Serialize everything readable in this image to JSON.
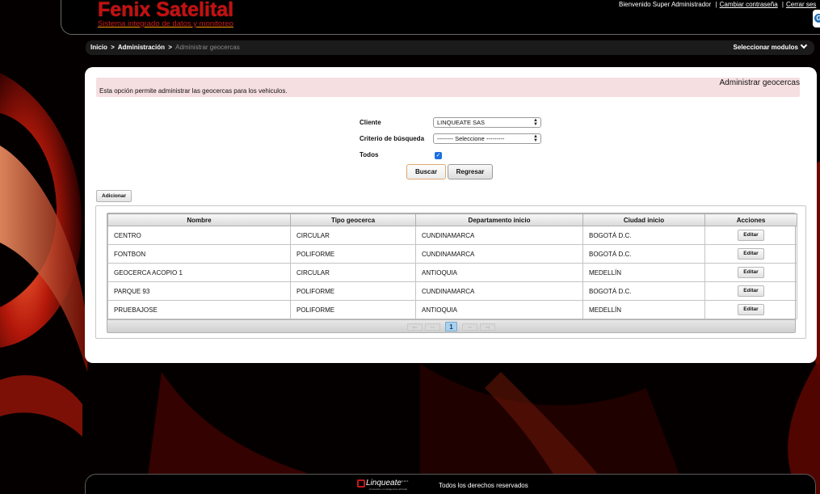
{
  "header": {
    "brand_title": "Fenix Satelital",
    "brand_subtitle": "Sistema integrado de datos y monitoreo",
    "welcome_text": "Bienvenido Super Administrador",
    "separator": "|",
    "change_password": "Cambiar contraseña",
    "logout": "Cerrar ses",
    "side_tab_glyph": "G"
  },
  "breadcrumb": {
    "items": [
      "Inicio",
      "Administración"
    ],
    "arrow": ">",
    "current": "Administrar geocercas",
    "module_select": "Seleccionar modulos"
  },
  "info": {
    "title": "Administrar geocercas",
    "text": "Esta opción permite administrar las geocercas para los vehiculos."
  },
  "form": {
    "cliente_label": "Cliente",
    "cliente_value": "LINQUEATE SAS",
    "criterio_label": "Criterio de búsqueda",
    "criterio_value": "-------- Seleccione ---------",
    "todos_label": "Todos",
    "todos_checked": true,
    "search_button": "Buscar",
    "back_button": "Regresar"
  },
  "add_button": "Adicionar",
  "table": {
    "headers": [
      "Nombre",
      "Tipo geocerca",
      "Departamento inicio",
      "Ciudad inicio",
      "Acciones"
    ],
    "rows": [
      [
        "CENTRO",
        "CIRCULAR",
        "CUNDINAMARCA",
        "BOGOTÁ D.C.",
        "Editar"
      ],
      [
        "FONTBON",
        "POLIFORME",
        "CUNDINAMARCA",
        "BOGOTÁ D.C.",
        "Editar"
      ],
      [
        "GEOCERCA ACOPIO 1",
        "CIRCULAR",
        "ANTIOQUIA",
        "MEDELLÍN",
        "Editar"
      ],
      [
        "PARQUE 93",
        "POLIFORME",
        "CUNDINAMARCA",
        "BOGOTÁ D.C.",
        "Editar"
      ],
      [
        "PRUEBAJOSE",
        "POLIFORME",
        "ANTIOQUIA",
        "MEDELLÍN",
        "Editar"
      ]
    ]
  },
  "pager": {
    "first": "|<<",
    "prev": "<<",
    "current_page": "1",
    "next": ">>",
    "last": ">>|"
  },
  "footer": {
    "logo_name": "Linqueate",
    "logo_suffix": "s.a.s",
    "logo_tagline": "innovación en inteligencia vehicular",
    "rights": "Todos los derechos reservados"
  },
  "colors": {
    "brand_red": "#c40f0f",
    "info_bg": "#f6dfe1",
    "checkbox_blue": "#1b6fe0",
    "pager_current": "#a9d2ef"
  }
}
